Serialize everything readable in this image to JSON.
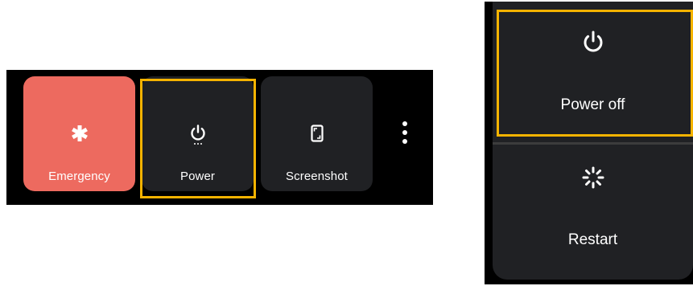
{
  "colors": {
    "tile_background": "#202124",
    "emergency_background": "#ed6a5f",
    "highlight": "#f5b300",
    "menu_background": "#000000"
  },
  "power_menu": {
    "tiles": [
      {
        "label": "Emergency",
        "icon": "asterisk-icon"
      },
      {
        "label": "Power",
        "icon": "power-icon"
      },
      {
        "label": "Screenshot",
        "icon": "screenshot-icon"
      }
    ],
    "more_icon": "more-vertical-icon"
  },
  "power_options": {
    "items": [
      {
        "label": "Power off",
        "icon": "power-icon"
      },
      {
        "label": "Restart",
        "icon": "restart-icon"
      }
    ]
  }
}
